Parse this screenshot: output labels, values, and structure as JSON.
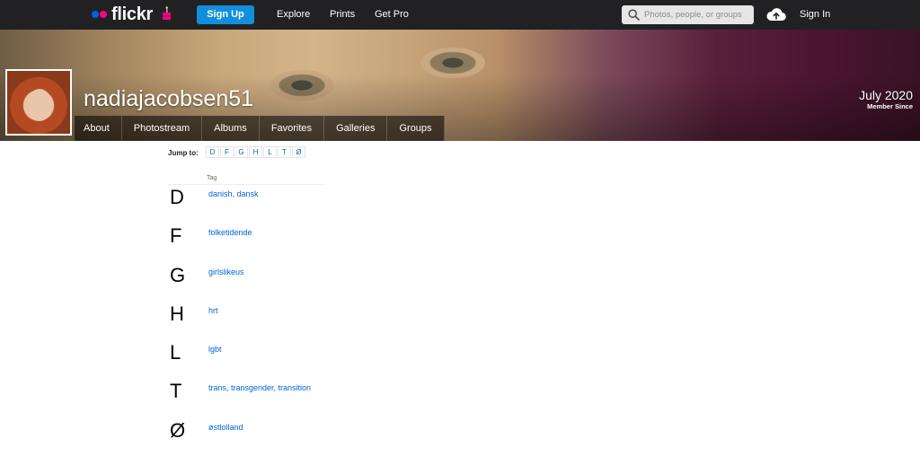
{
  "topnav": {
    "logo": "flickr",
    "signup": "Sign Up",
    "links": [
      "Explore",
      "Prints",
      "Get Pro"
    ],
    "search_placeholder": "Photos, people, or groups",
    "signin": "Sign In",
    "icons": [
      "cake-icon",
      "search-icon",
      "upload-cloud-icon"
    ]
  },
  "profile": {
    "username": "nadiajacobsen51",
    "member_since_date": "July 2020",
    "member_since_label": "Member Since"
  },
  "subnav": {
    "tabs": [
      "About",
      "Photostream",
      "Albums",
      "Favorites",
      "Galleries",
      "Groups"
    ]
  },
  "jump": {
    "label": "Jump to:",
    "letters": [
      "D",
      "F",
      "G",
      "H",
      "L",
      "T",
      "Ø"
    ]
  },
  "tags": {
    "header": "Tag",
    "groups": [
      {
        "letter": "D",
        "tags": "danish, dansk"
      },
      {
        "letter": "F",
        "tags": "folketidende"
      },
      {
        "letter": "G",
        "tags": "girlslikeus"
      },
      {
        "letter": "H",
        "tags": "hrt"
      },
      {
        "letter": "L",
        "tags": "lgbt"
      },
      {
        "letter": "T",
        "tags": "trans, transgender, transition"
      },
      {
        "letter": "Ø",
        "tags": "østlolland"
      }
    ]
  },
  "colors": {
    "topnav_bg": "#212124",
    "signup_bg": "#128fdc",
    "link_blue": "#0063dc",
    "logo_blue_dot": "#0063dc",
    "logo_pink_dot": "#ff0084"
  }
}
